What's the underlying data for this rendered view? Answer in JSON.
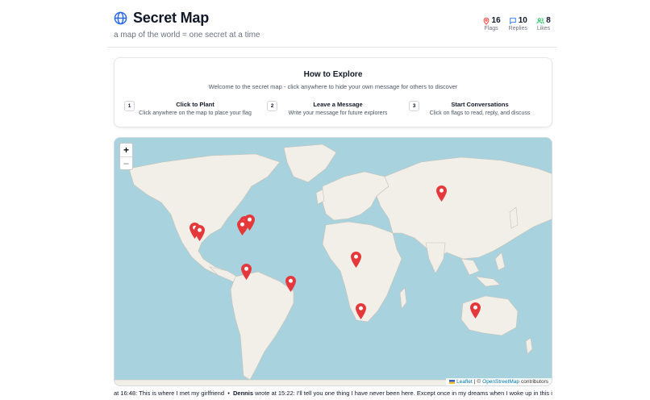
{
  "header": {
    "title": "Secret Map",
    "tagline": "a map of the world = one secret at a time"
  },
  "stats": [
    {
      "value": "16",
      "label": "Flags",
      "icon": "pin-icon",
      "color": "#ef4444"
    },
    {
      "value": "10",
      "label": "Replies",
      "icon": "chat-icon",
      "color": "#3b82f6"
    },
    {
      "value": "8",
      "label": "Likes",
      "icon": "users-icon",
      "color": "#22c55e"
    }
  ],
  "howto": {
    "title": "How to Explore",
    "welcome": "Welcome to the secret map - click anywhere to hide your own message for others to discover",
    "steps": [
      {
        "num": "1",
        "title": "Click to Plant",
        "desc": "Click anywhere on the map to place your flag"
      },
      {
        "num": "2",
        "title": "Leave a Message",
        "desc": "Write your message for future explorers"
      },
      {
        "num": "3",
        "title": "Start Conversations",
        "desc": "Click on flags to read, reply, and discuss"
      }
    ]
  },
  "map": {
    "zoom_in": "+",
    "zoom_out": "−",
    "attribution_leaflet": "Leaflet",
    "attribution_sep": "|",
    "attribution_copy": "©",
    "attribution_osm": "OpenStreetMap",
    "attribution_tail": "contributors",
    "pin_color": "#e5383b",
    "water_color": "#a8d2de",
    "land_color": "#f2efe9"
  },
  "ticker": {
    "part1_prefix": "at 16:48:",
    "part1_text": "This is where I met my girlfriend",
    "bullet": "•",
    "part2_name": "Dennis",
    "part2_prefix": "wrote at 15:22:",
    "part2_text": "I'll tell you one thing I have never been here. Except once in my dreams when I woke up in this i"
  }
}
